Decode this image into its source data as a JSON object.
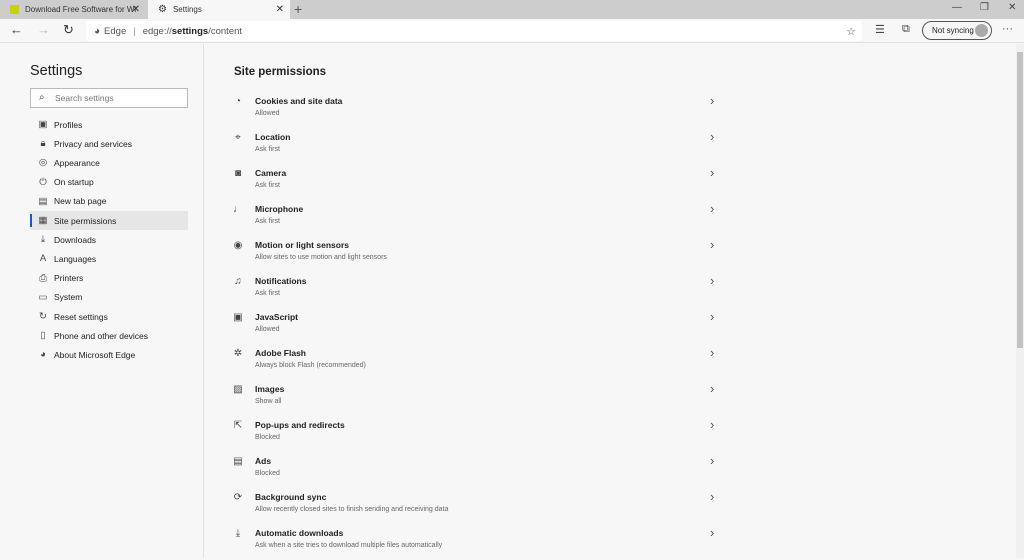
{
  "tabs": [
    {
      "label": "Download Free Software for Wi",
      "icon": "site-favicon"
    },
    {
      "label": "Settings",
      "icon": "gear-icon"
    }
  ],
  "address": {
    "site_label": "Edge",
    "url_prefix": "edge://",
    "url_bold": "settings",
    "url_suffix": "/content"
  },
  "toolbar": {
    "sync_label": "Not syncing"
  },
  "sidebar": {
    "title": "Settings",
    "search_placeholder": "Search settings",
    "items": [
      {
        "label": "Profiles",
        "icon": "profile-icon"
      },
      {
        "label": "Privacy and services",
        "icon": "lock-icon"
      },
      {
        "label": "Appearance",
        "icon": "palette-icon"
      },
      {
        "label": "On startup",
        "icon": "power-icon"
      },
      {
        "label": "New tab page",
        "icon": "newtab-icon"
      },
      {
        "label": "Site permissions",
        "icon": "site-permissions-icon",
        "active": true
      },
      {
        "label": "Downloads",
        "icon": "download-icon"
      },
      {
        "label": "Languages",
        "icon": "languages-icon"
      },
      {
        "label": "Printers",
        "icon": "printer-icon"
      },
      {
        "label": "System",
        "icon": "laptop-icon"
      },
      {
        "label": "Reset settings",
        "icon": "reset-icon"
      },
      {
        "label": "Phone and other devices",
        "icon": "phone-icon"
      },
      {
        "label": "About Microsoft Edge",
        "icon": "edge-icon"
      }
    ]
  },
  "main": {
    "title": "Site permissions",
    "items": [
      {
        "label": "Cookies and site data",
        "sub": "Allowed",
        "icon": "cookie-icon"
      },
      {
        "label": "Location",
        "sub": "Ask first",
        "icon": "location-icon"
      },
      {
        "label": "Camera",
        "sub": "Ask first",
        "icon": "camera-icon"
      },
      {
        "label": "Microphone",
        "sub": "Ask first",
        "icon": "microphone-icon"
      },
      {
        "label": "Motion or light sensors",
        "sub": "Allow sites to use motion and light sensors",
        "icon": "sensor-icon"
      },
      {
        "label": "Notifications",
        "sub": "Ask first",
        "icon": "bell-icon"
      },
      {
        "label": "JavaScript",
        "sub": "Allowed",
        "icon": "javascript-icon"
      },
      {
        "label": "Adobe Flash",
        "sub": "Always block Flash (recommended)",
        "icon": "puzzle-icon"
      },
      {
        "label": "Images",
        "sub": "Show all",
        "icon": "image-icon"
      },
      {
        "label": "Pop-ups and redirects",
        "sub": "Blocked",
        "icon": "popup-icon"
      },
      {
        "label": "Ads",
        "sub": "Blocked",
        "icon": "ads-icon"
      },
      {
        "label": "Background sync",
        "sub": "Allow recently closed sites to finish sending and receiving data",
        "icon": "sync-icon"
      },
      {
        "label": "Automatic downloads",
        "sub": "Ask when a site tries to download multiple files automatically",
        "icon": "download-icon"
      }
    ]
  }
}
